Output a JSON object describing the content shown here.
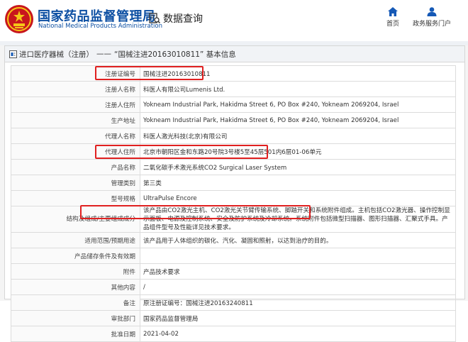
{
  "header": {
    "brand_cn": "国家药品监督管理局",
    "brand_en": "National Medical Products Administration",
    "query_label": "数据查询",
    "nav": [
      {
        "label": "首页",
        "icon": "home-icon"
      },
      {
        "label": "政务服务门户",
        "icon": "user-icon"
      }
    ]
  },
  "breadcrumb": {
    "category": "进口医疗器械（注册）",
    "separator": "——",
    "title": "“国械注进20163010811” 基本信息"
  },
  "rows": [
    {
      "key": "注册证编号",
      "value": "国械注进20163010811"
    },
    {
      "key": "注册人名称",
      "value": "科医人有限公司Lumenis Ltd."
    },
    {
      "key": "注册人住所",
      "value": "Yokneam Industrial Park, Hakidma Street 6, PO Box #240, Yokneam 2069204, Israel"
    },
    {
      "key": "生产地址",
      "value": "Yokneam Industrial Park, Hakidma Street 6, PO Box #240, Yokneam 2069204, Israel"
    },
    {
      "key": "代理人名称",
      "value": "科医人激光科技(北京)有限公司"
    },
    {
      "key": "代理人住所",
      "value": "北京市朝阳区金和东路20号院3号楼5至45层501内6层01-06单元"
    },
    {
      "key": "产品名称",
      "value": "二氧化碳手术激光系统CO2 Surgical Laser System"
    },
    {
      "key": "管理类别",
      "value": "第三类"
    },
    {
      "key": "型号规格",
      "value": "UltraPulse Encore"
    },
    {
      "key": "结构及组成/主要组成成分",
      "value": "该产品由CO2激光主机、CO2激光关节臂传输系统、脚踏开关和系统附件组成。主机包括CO2激光器、操作控制显示面板、电源及控制系统、安全及防护系统及冷却系统。系统附件包括微型扫描器、图形扫描器、汇聚式手具。产品组件型号及性能详见技术要求。"
    },
    {
      "key": "适用范围/预期用途",
      "value": "该产品用于人体组织的碳化、汽化、凝固和照射，以达到治疗的目的。"
    },
    {
      "key": "产品储存条件及有效期",
      "value": ""
    },
    {
      "key": "附件",
      "value": "产品技术要求"
    },
    {
      "key": "其他内容",
      "value": "/"
    },
    {
      "key": "备注",
      "value": "原注册证编号：国械注进20163240811"
    },
    {
      "key": "审批部门",
      "value": "国家药品监督管理局"
    },
    {
      "key": "批准日期",
      "value": "2021-04-02"
    }
  ],
  "colors": {
    "brand": "#0b4ea2",
    "highlight": "#e02020"
  }
}
